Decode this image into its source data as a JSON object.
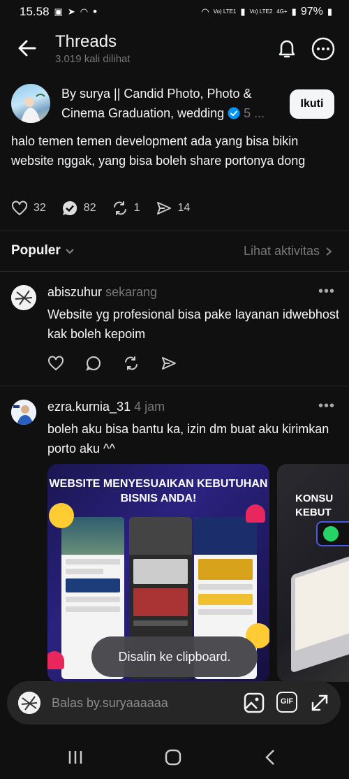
{
  "status_bar": {
    "time": "15.58",
    "battery": "97%",
    "net1": "Vo) LTE1",
    "net2": "Vo) LTE2",
    "net_4g": "4G+"
  },
  "header": {
    "title": "Threads",
    "views": "3.019 kali dilihat"
  },
  "post": {
    "author_line1": "By surya || Candid Photo, Photo &",
    "author_line2": "Cinema Graduation, wedding",
    "author_suffix": "5 ...",
    "follow_label": "Ikuti",
    "text": "halo temen temen development ada yang bisa bikin website nggak, yang bisa boleh share portonya dong",
    "likes": "32",
    "replies": "82",
    "reposts": "1",
    "shares": "14"
  },
  "sort": {
    "label": "Populer",
    "activity": "Lihat aktivitas"
  },
  "replies": [
    {
      "username": "abiszuhur",
      "time": "sekarang",
      "text": "Website yg profesional bisa pake layanan idwebhost kak boleh kepoim"
    },
    {
      "username": "ezra.kurnia_31",
      "time": "4 jam",
      "text": "boleh aku bisa bantu ka, izin dm buat aku kirimkan porto aku ^^",
      "media": [
        {
          "banner": "WEBSITE MENYESUAIKAN KEBUTUHAN BISNIS ANDA!"
        },
        {
          "banner": "KONSU KEBUT"
        }
      ]
    }
  ],
  "toast": "Disalin ke clipboard.",
  "reply_bar": {
    "placeholder": "Balas by.suryaaaaaa",
    "gif_label": "GIF"
  },
  "colors": {
    "background": "#101010",
    "text": "#f3f5f7",
    "muted": "#777777",
    "verified": "#0095f6"
  }
}
